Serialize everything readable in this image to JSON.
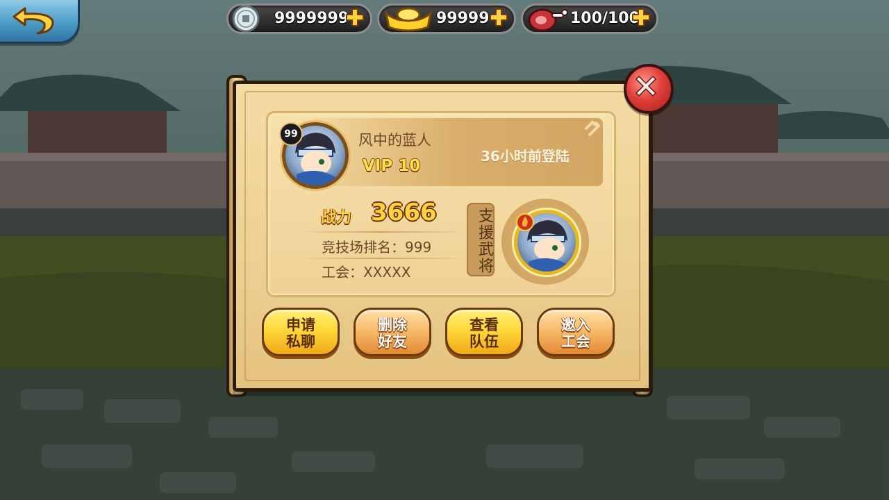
{
  "resources": [
    {
      "icon": "copper-coin-icon",
      "value": "9999999"
    },
    {
      "icon": "gold-ingot-icon",
      "value": "99999"
    },
    {
      "icon": "meat-stamina-icon",
      "value": "100/100"
    }
  ],
  "player": {
    "level": "99",
    "name": "风中的蓝人",
    "vip": "VIP 10",
    "last_login": "36小时前登陆"
  },
  "stats": {
    "power_label": "战力",
    "power_value": "3666",
    "arena_rank": "竞技场排名：999",
    "guild": "工会：XXXXX"
  },
  "support": {
    "label": "支援武将"
  },
  "actions": [
    {
      "line1": "申请",
      "line2": "私聊",
      "style": "yellow"
    },
    {
      "line1": "删除",
      "line2": "好友",
      "style": "orange"
    },
    {
      "line1": "查看",
      "line2": "队伍",
      "style": "yellow"
    },
    {
      "line1": "邀入",
      "line2": "工会",
      "style": "orange"
    }
  ],
  "colors": {
    "panel": "#f3dca3",
    "accent_gold": "#ffd23f",
    "close_red": "#e0403a",
    "back_blue": "#4d9cc6"
  }
}
